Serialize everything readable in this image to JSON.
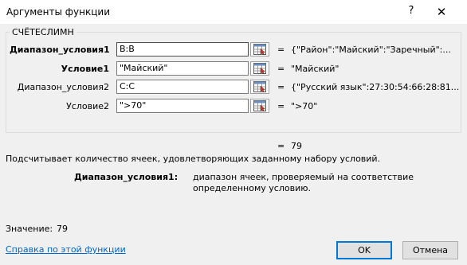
{
  "window": {
    "title": "Аргументы функции",
    "help_label": "?",
    "close_label": "✕"
  },
  "function_name": "СЧЁТЕСЛИМН",
  "arguments": [
    {
      "label": "Диапазон_условия1",
      "value": "B:B",
      "result": "{\"Район\":\"Майский\":\"Заречный\":...",
      "bold": true
    },
    {
      "label": "Условие1",
      "value": "\"Майский\"",
      "result": "\"Майский\"",
      "bold": true
    },
    {
      "label": "Диапазон_условия2",
      "value": "C:C",
      "result": "{\"Русский язык\":27:30:54:66:28:81...",
      "bold": false
    },
    {
      "label": "Условие2",
      "value": "\">70\"",
      "result": "\">70\"",
      "bold": false
    }
  ],
  "equals_sign": "=",
  "formula_result": "79",
  "function_description": "Подсчитывает количество ячеек, удовлетворяющих заданному набору условий.",
  "argument_help": {
    "label": "Диапазон_условия1:",
    "text": "диапазон ячеек, проверяемый на соответствие определенному условию."
  },
  "value_label": "Значение:",
  "value": "79",
  "help_link": "Справка по этой функции",
  "buttons": {
    "ok": "OK",
    "cancel": "Отмена"
  }
}
